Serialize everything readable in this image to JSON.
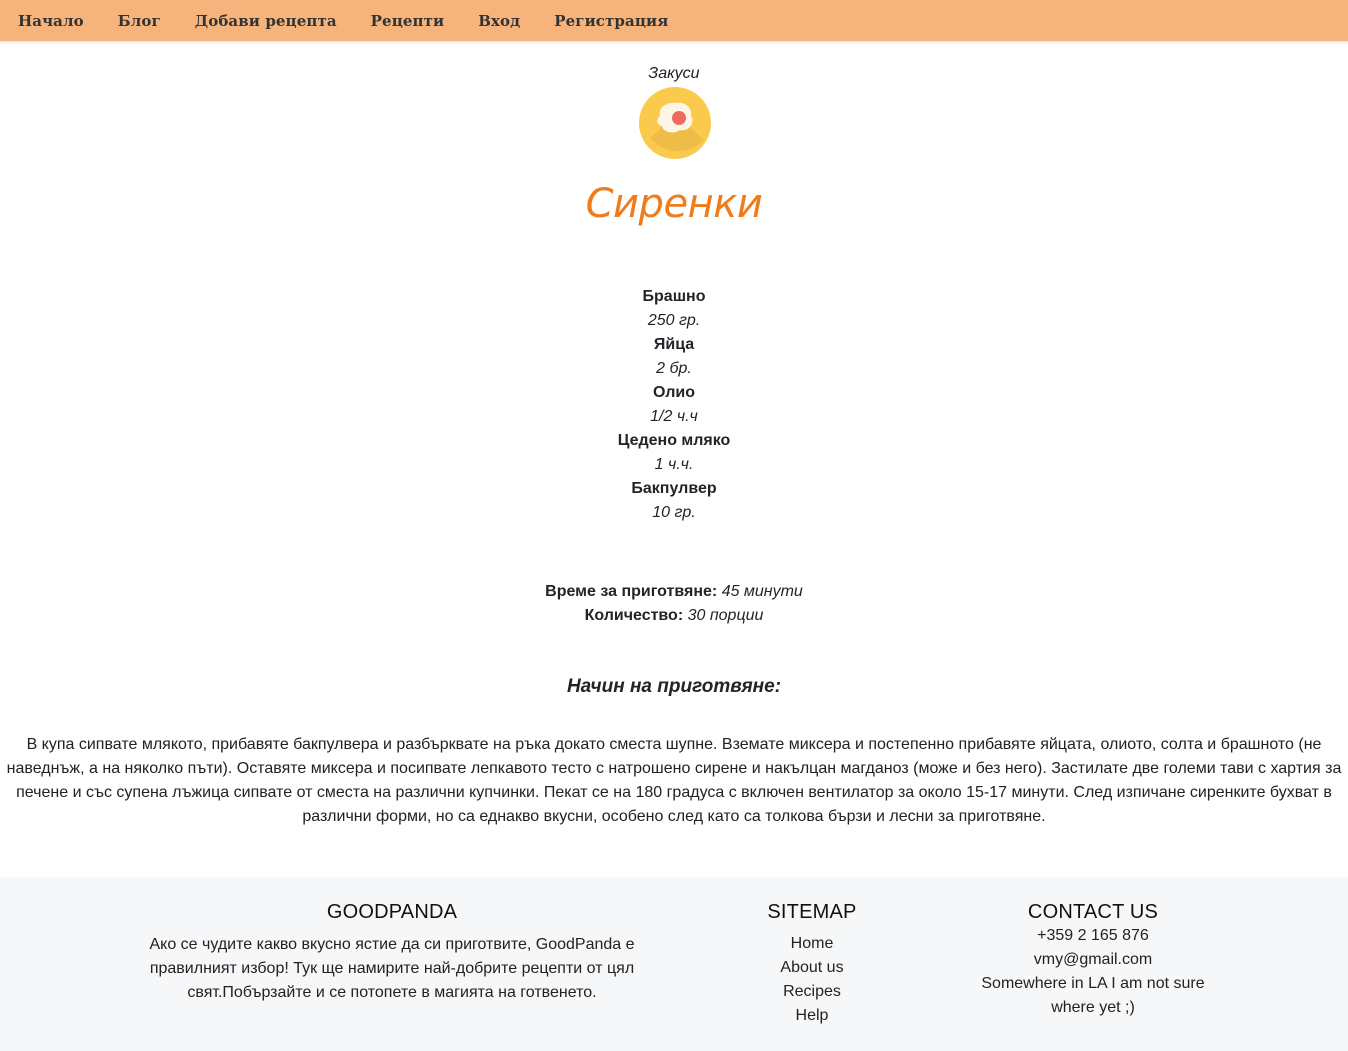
{
  "nav": {
    "items": [
      {
        "label": "Начало"
      },
      {
        "label": "Блог"
      },
      {
        "label": "Добави рецепта"
      },
      {
        "label": "Рецепти"
      },
      {
        "label": "Вход"
      },
      {
        "label": "Регистрация"
      }
    ]
  },
  "recipe": {
    "category": "Закуси",
    "category_icon": "fried-egg-icon",
    "title": "Сиренки",
    "ingredients": [
      {
        "name": "Брашно",
        "quantity": "250 гр."
      },
      {
        "name": "Яйца",
        "quantity": "2 бр."
      },
      {
        "name": "Олио",
        "quantity": "1/2 ч.ч"
      },
      {
        "name": "Цедено мляко",
        "quantity": "1 ч.ч."
      },
      {
        "name": "Бакпулвер",
        "quantity": "10 гр."
      }
    ],
    "prep_time_label": "Време за приготвяне:",
    "prep_time_value": "45 минути",
    "servings_label": "Количество:",
    "servings_value": "30 порции",
    "method_heading": "Начин на приготвяне:",
    "method_text": "В купа сипвате млякото, прибавяте бакпулвера и разбърквате на ръка докато сместа шупне. Вземате миксера и постепенно прибавяте яйцата, олиото, солта и брашното (не наведнъж, а на няколко пъти). Оставяте миксера и посипвате лепкавото тесто с натрошено сирене и накълцан магданоз (може и без него). Застилате две големи тави с хартия за печене и със супена лъжица сипвате от сместа на различни купчинки. Пекат се на 180 градуса с включен вентилатор за около 15-17 минути. След изпичане сиренките бухват в различни форми, но са еднакво вкусни, особено след като са толкова бързи и лесни за приготвяне."
  },
  "footer": {
    "about": {
      "heading": "GOODPANDA",
      "text": "Ако се чудите какво вкусно ястие да си приготвите, GoodPanda е правилният избор! Тук ще намирите най-добрите рецепти от цял свят.Побързайте и се потопете в магията на готвенето."
    },
    "sitemap": {
      "heading": "SITEMAP",
      "links": [
        {
          "label": "Home"
        },
        {
          "label": "About us"
        },
        {
          "label": "Recipes"
        },
        {
          "label": "Help"
        }
      ]
    },
    "contact": {
      "heading": "CONTACT US",
      "phone": "+359 2 165 876",
      "email": "vmy@gmail.com",
      "address": "Somewhere in LA I am not sure where yet ;)"
    }
  },
  "colors": {
    "nav_bg": "#f6b37c",
    "title": "#ef7b1a",
    "footer_bg": "#f6f7f9"
  }
}
